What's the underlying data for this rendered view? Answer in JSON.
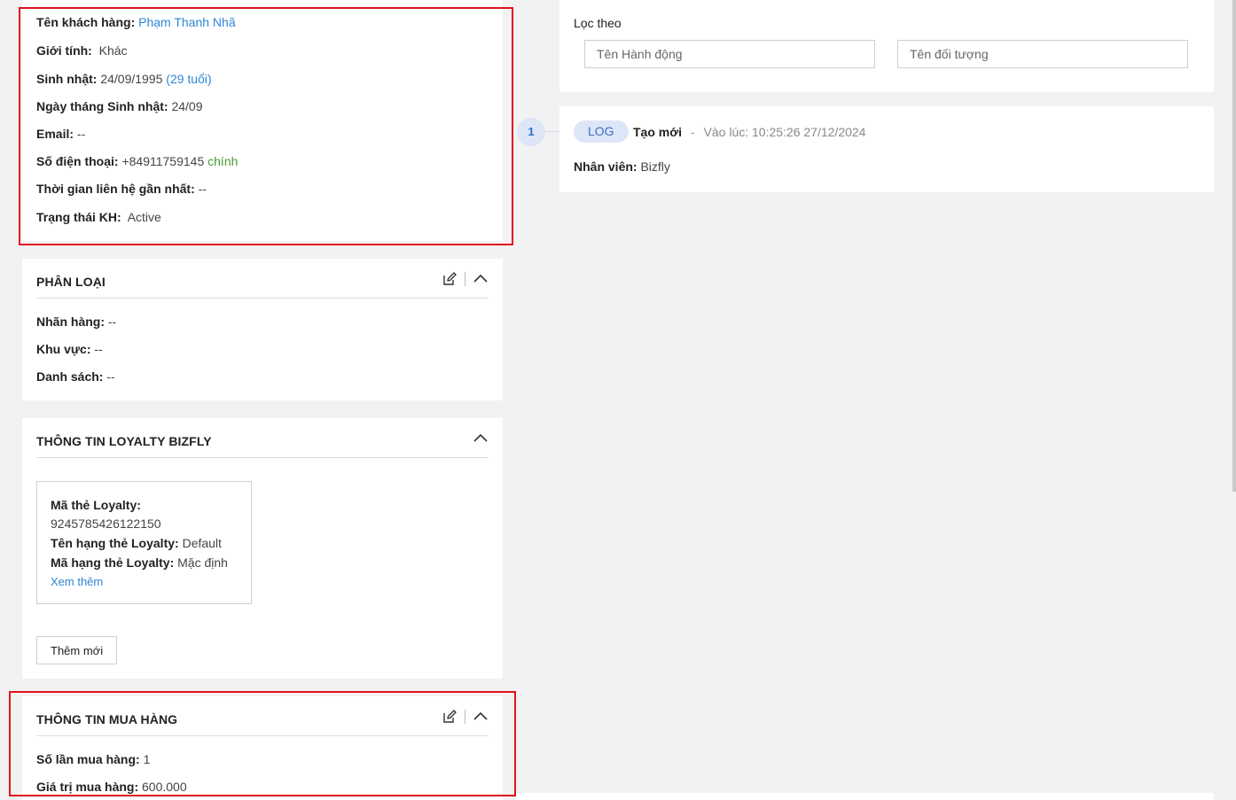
{
  "customer": {
    "name_label": "Tên khách hàng:",
    "name_value": "Phạm Thanh Nhã",
    "gender_label": "Giới tính:",
    "gender_value": "Khác",
    "birthday_label": "Sinh nhật:",
    "birthday_value": "24/09/1995",
    "age_value": "(29 tuổi)",
    "birth_daymonth_label": "Ngày tháng Sinh nhật:",
    "birth_daymonth_value": "24/09",
    "email_label": "Email:",
    "email_value": "--",
    "phone_label": "Số điện thoại:",
    "phone_value": "+84911759145",
    "phone_tag": "chính",
    "last_contact_label": "Thời gian liên hệ gần nhất:",
    "last_contact_value": "--",
    "status_label": "Trạng thái KH:",
    "status_value": "Active"
  },
  "classification": {
    "title": "PHÂN LOẠI",
    "brand_label": "Nhãn hàng:",
    "brand_value": "--",
    "region_label": "Khu vực:",
    "region_value": "--",
    "list_label": "Danh sách:",
    "list_value": "--"
  },
  "loyalty": {
    "title": "THÔNG TIN LOYALTY BIZFLY",
    "card_code_label": "Mã thẻ Loyalty:",
    "card_code_value": "9245785426122150",
    "tier_name_label": "Tên hạng thẻ Loyalty:",
    "tier_name_value": "Default",
    "tier_code_label": "Mã hạng thẻ Loyalty:",
    "tier_code_value": "Mặc định",
    "view_more": "Xem thêm",
    "add_new": "Thêm mới"
  },
  "purchase": {
    "title": "THÔNG TIN MUA HÀNG",
    "count_label": "Số lần mua hàng:",
    "count_value": "1",
    "value_label": "Giá trị mua hàng:",
    "value_value": "600.000"
  },
  "filter": {
    "title": "Lọc theo",
    "action_placeholder": "Tên Hành động",
    "object_placeholder": "Tên đối tượng"
  },
  "log": {
    "index": "1",
    "badge": "LOG",
    "action": "Tạo mới",
    "separator": "-",
    "time": "Vào lúc: 10:25:26 27/12/2024",
    "staff_label": "Nhân viên:",
    "staff_value": "Bizfly"
  },
  "colors": {
    "highlight": "#e0141e",
    "link": "#2f86d6",
    "tag_green": "#4a9a34",
    "badge_bg": "#dde6f7"
  }
}
